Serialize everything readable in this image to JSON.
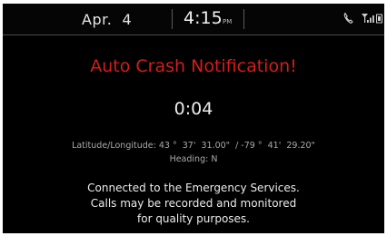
{
  "status_bar": {
    "date": "Apr.  4",
    "time": "4:15",
    "ampm": "PM",
    "icons": [
      "phone-icon",
      "signal-icon"
    ]
  },
  "alert": {
    "title": "Auto Crash Notification!",
    "timer": "0:04",
    "coordinates": "Latitude/Longitude: 43 °  37'  31.00\"  / -79 °  41'  29.20\"",
    "heading": "Heading: N",
    "message_lines": [
      "Connected to the Emergency Services.",
      "Calls may be recorded and monitored",
      "for quality purposes."
    ]
  },
  "colors": {
    "background": "#000000",
    "alert_red": "#d51c1c",
    "text": "#ececec",
    "secondary_text": "#a9a9a9"
  }
}
